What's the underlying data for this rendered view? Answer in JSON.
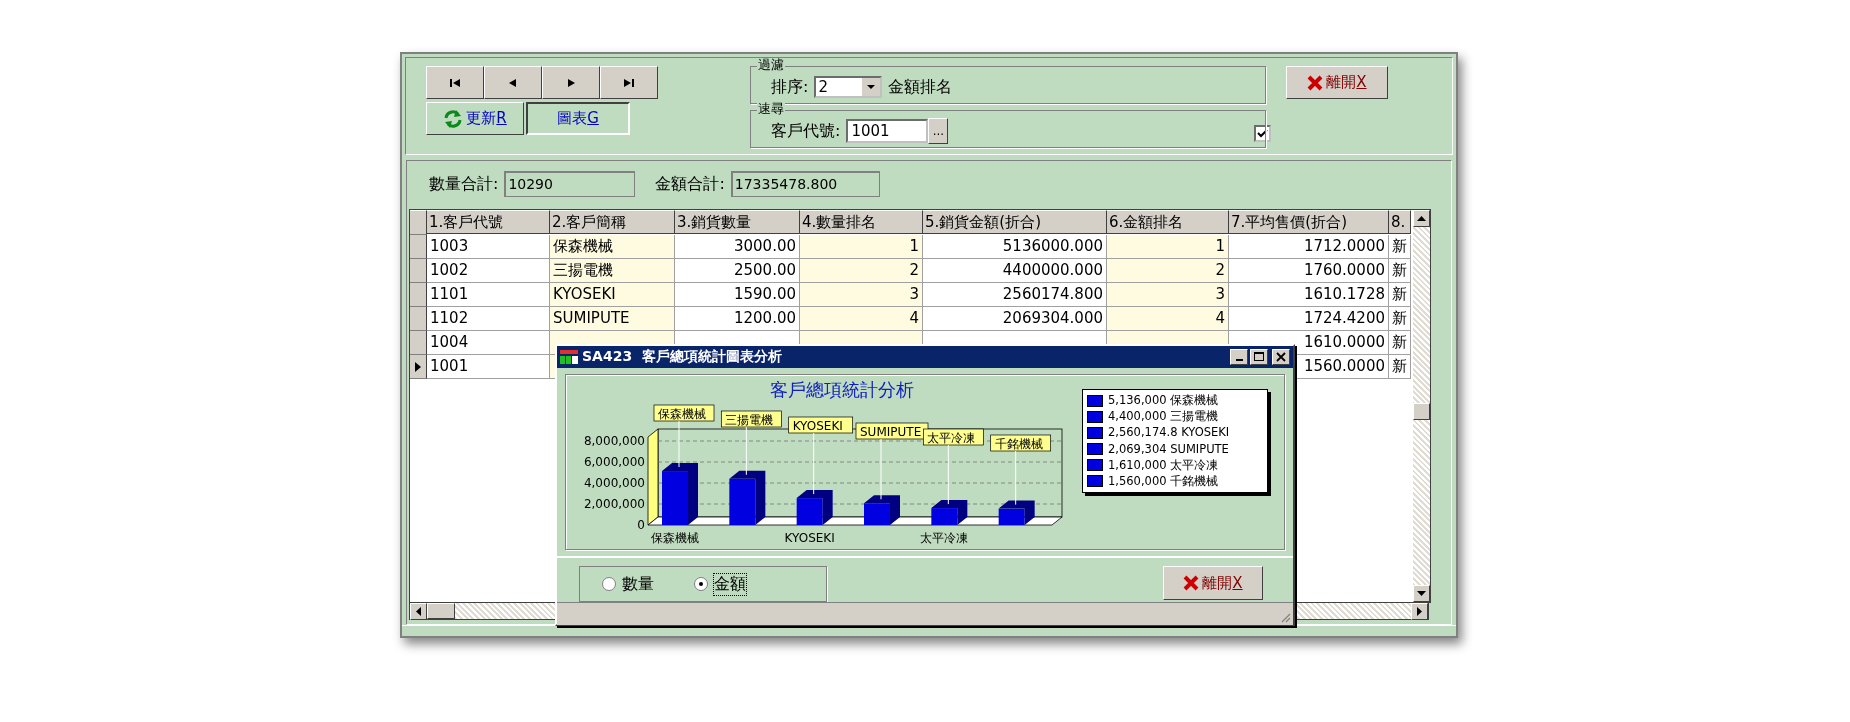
{
  "toolbar": {
    "refresh_button": {
      "label": "更新",
      "shortcut": "R"
    },
    "chart_button": {
      "label": "圖表",
      "shortcut": "G"
    }
  },
  "filter": {
    "legend": "過濾",
    "sort_label": "排序:",
    "sort_value": "2",
    "sort_description": "金額排名"
  },
  "quick_search": {
    "legend": "速尋",
    "label": "客戶代號:",
    "value": "1001",
    "browse_button": "..."
  },
  "close_button": {
    "label": "離開",
    "shortcut": "X"
  },
  "option_checkbox": {
    "checked": true
  },
  "totals": [
    {
      "label": "數量合計:",
      "value": "10290"
    },
    {
      "label": "金額合計:",
      "value": "17335478.800"
    }
  ],
  "table": {
    "columns": [
      {
        "label": "1.客戶代號",
        "kind": "text",
        "shaded": false
      },
      {
        "label": "2.客戶簡稱",
        "kind": "text",
        "shaded": true
      },
      {
        "label": "3.銷貨數量",
        "kind": "number",
        "shaded": false
      },
      {
        "label": "4.數量排名",
        "kind": "number",
        "shaded": true
      },
      {
        "label": "5.銷貨金額(折合)",
        "kind": "number",
        "shaded": false
      },
      {
        "label": "6.金額排名",
        "kind": "number",
        "shaded": true
      },
      {
        "label": "7.平均售價(折合)",
        "kind": "number",
        "shaded": false
      },
      {
        "label": "8.",
        "kind": "text",
        "shaded": false
      }
    ],
    "rows": [
      {
        "current": false,
        "cells": [
          "1003",
          "保森機械",
          "3000.00",
          "1",
          "5136000.000",
          "1",
          "1712.0000",
          "新"
        ]
      },
      {
        "current": false,
        "cells": [
          "1002",
          "三揚電機",
          "2500.00",
          "2",
          "4400000.000",
          "2",
          "1760.0000",
          "新"
        ]
      },
      {
        "current": false,
        "cells": [
          "1101",
          "KYOSEKI",
          "1590.00",
          "3",
          "2560174.800",
          "3",
          "1610.1728",
          "新"
        ]
      },
      {
        "current": false,
        "cells": [
          "1102",
          "SUMIPUTE",
          "1200.00",
          "4",
          "2069304.000",
          "4",
          "1724.4200",
          "新"
        ]
      },
      {
        "current": false,
        "cells": [
          "1004",
          null,
          null,
          null,
          null,
          null,
          "1610.0000",
          "新"
        ]
      },
      {
        "current": true,
        "cells": [
          "1001",
          null,
          null,
          null,
          null,
          null,
          "1560.0000",
          "新"
        ]
      }
    ]
  },
  "popup": {
    "title": "SA423  客戶總項統計圖表分析",
    "chart_data": {
      "type": "bar",
      "title": "客戶總項統計分析",
      "categories": [
        "保森機械",
        "三揚電機",
        "KYOSEKI",
        "SUMIPUTE",
        "太平冷凍",
        "千銘機械"
      ],
      "series": [
        {
          "color": "#0000e0",
          "values": [
            5136000,
            4400000,
            2560174.8,
            2069304,
            1610000,
            1560000
          ]
        }
      ],
      "ylim": [
        0,
        8000000
      ],
      "grid": true,
      "yticks": [
        {
          "value": 0,
          "label": "0"
        },
        {
          "value": 2000000,
          "label": "2,000,000"
        },
        {
          "value": 4000000,
          "label": "4,000,000"
        },
        {
          "value": 6000000,
          "label": "6,000,000"
        },
        {
          "value": 8000000,
          "label": "8,000,000"
        }
      ]
    },
    "legend": [
      "5,136,000 保森機械",
      "4,400,000 三揚電機",
      "2,560,174.8 KYOSEKI",
      "2,069,304 SUMIPUTE",
      "1,610,000 太平冷凍",
      "1,560,000 千銘機械"
    ],
    "radios": [
      {
        "label": "數量",
        "selected": false
      },
      {
        "label": "金額",
        "selected": true
      }
    ],
    "close_button": {
      "label": "離開",
      "shortcut": "X"
    }
  }
}
